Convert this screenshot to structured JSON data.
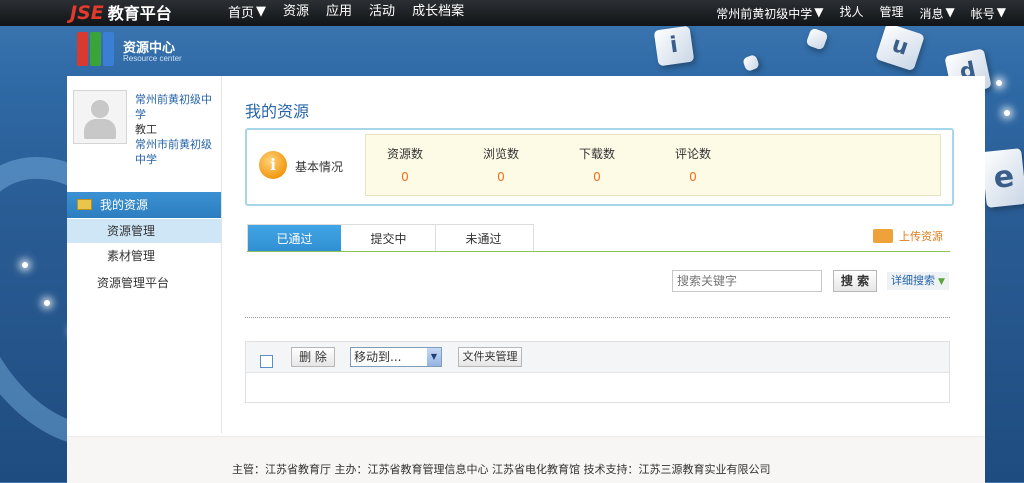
{
  "topbar": {
    "logo_jse": "JSE",
    "logo_text": "教育平台",
    "nav": [
      "首页",
      "资源",
      "应用",
      "活动",
      "成长档案"
    ],
    "right_nav": [
      "常州前黄初级中学",
      "找人",
      "管理",
      "消息",
      "帐号"
    ]
  },
  "header": {
    "title": "资源中心",
    "subtitle": "Resource center"
  },
  "decor": {
    "cube_letters": [
      "i",
      "u",
      "d",
      "e"
    ]
  },
  "user": {
    "school": "常州前黄初级中学",
    "role": "教工",
    "city_school": "常州市前黄初级中学"
  },
  "sidebar": {
    "main_item": "我的资源",
    "sub_items": [
      "资源管理",
      "素材管理"
    ],
    "platform_item": "资源管理平台"
  },
  "content": {
    "title": "我的资源",
    "stats_label": "基本情况",
    "stats": [
      {
        "name": "资源数",
        "value": "0"
      },
      {
        "name": "浏览数",
        "value": "0"
      },
      {
        "name": "下载数",
        "value": "0"
      },
      {
        "name": "评论数",
        "value": "0"
      }
    ],
    "tabs": [
      "已通过",
      "提交中",
      "未通过"
    ],
    "upload_label": "上传资源",
    "search_placeholder": "搜索关键字",
    "search_button": "搜 索",
    "advanced_search": "详细搜索",
    "toolbar": {
      "delete_label": "删 除",
      "move_to": "移动到...",
      "folder_manage": "文件夹管理"
    }
  },
  "footer": {
    "text": "主管：江苏省教育厅   主办：江苏省教育管理信息中心  江苏省电化教育馆   技术支持：江苏三源教育实业有限公司"
  },
  "colors": {
    "accent_blue": "#2f8fd2",
    "link_blue": "#2765a8",
    "stat_value_orange": "#e8701a"
  }
}
